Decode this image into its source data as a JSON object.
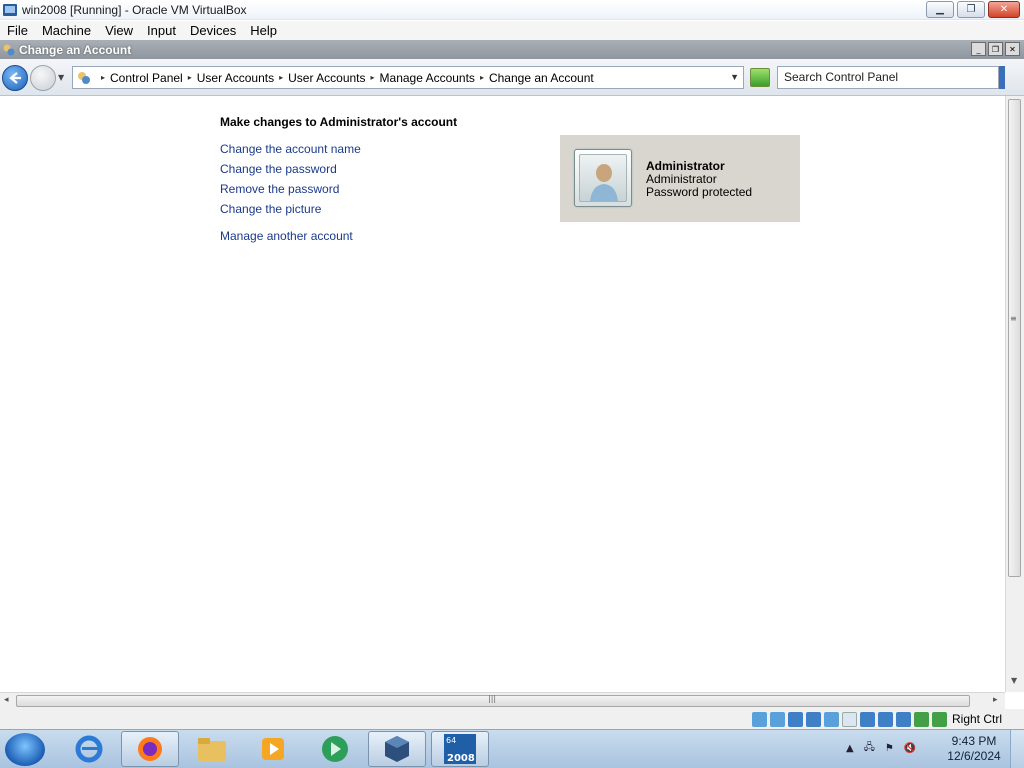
{
  "vbox": {
    "title": "win2008 [Running] - Oracle VM VirtualBox",
    "menu": [
      "File",
      "Machine",
      "View",
      "Input",
      "Devices",
      "Help"
    ],
    "host_key": "Right Ctrl"
  },
  "window": {
    "title": "Change an Account"
  },
  "address": {
    "crumbs": [
      "Control Panel",
      "User Accounts",
      "User Accounts",
      "Manage Accounts",
      "Change an Account"
    ],
    "search_placeholder": "Search Control Panel"
  },
  "main": {
    "heading": "Make changes to Administrator's account",
    "links": [
      "Change the account name",
      "Change the password",
      "Remove the password",
      "Change the picture",
      "Manage another account"
    ]
  },
  "account": {
    "name": "Administrator",
    "role": "Administrator",
    "status": "Password protected"
  },
  "taskbar": {
    "apps": [
      "internet-explorer",
      "firefox",
      "file-explorer",
      "media-player",
      "app-green",
      "virtualbox",
      "win2008"
    ],
    "time": "9:43 PM",
    "date": "12/6/2024"
  },
  "colors": {
    "link": "#1a3a8a",
    "account_card_bg": "#d9d6cf",
    "guest_title_bg": "#9aa1a8"
  }
}
